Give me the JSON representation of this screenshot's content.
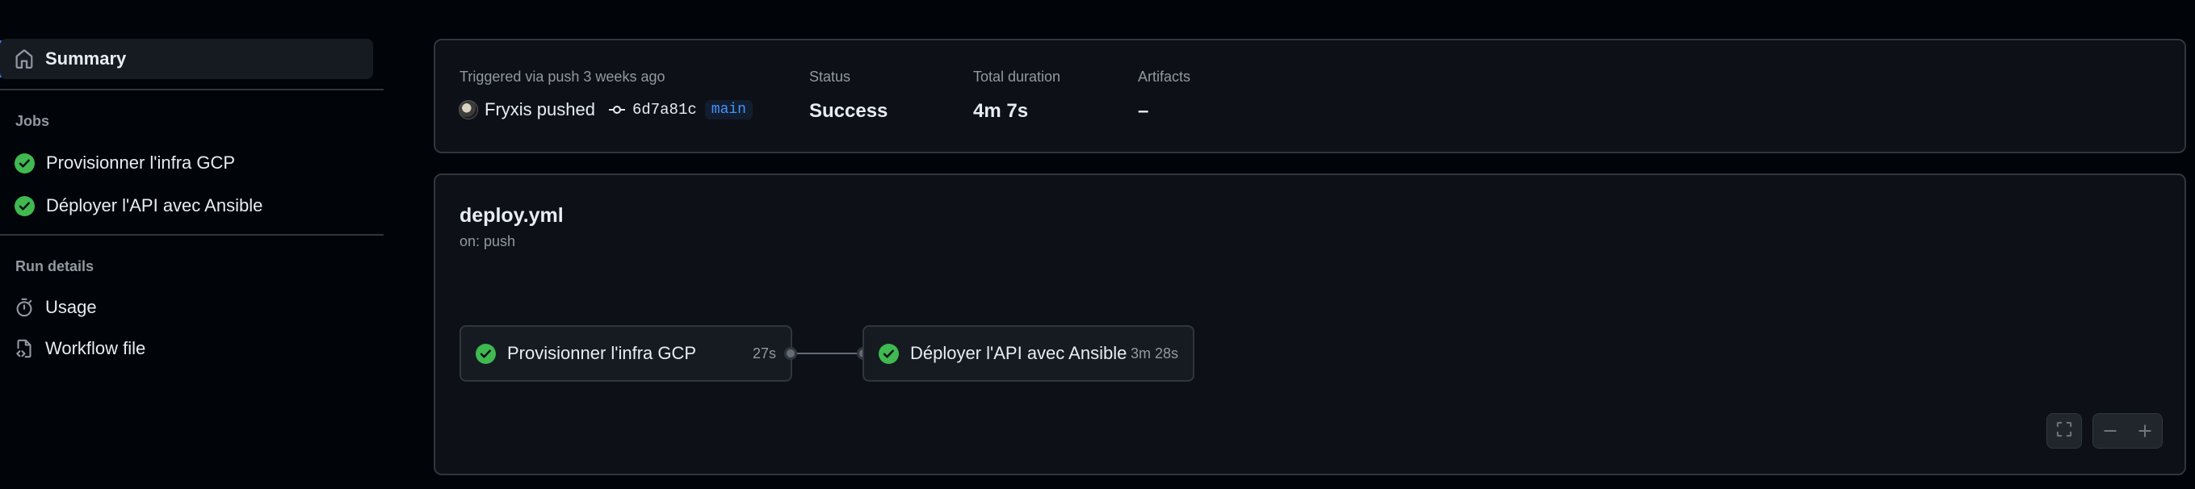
{
  "sidebar": {
    "summary_label": "Summary",
    "jobs_heading": "Jobs",
    "jobs": [
      {
        "label": "Provisionner l'infra GCP",
        "status": "success"
      },
      {
        "label": "Déployer l'API avec Ansible",
        "status": "success"
      }
    ],
    "run_details_heading": "Run details",
    "usage_label": "Usage",
    "workflow_file_label": "Workflow file"
  },
  "summary_card": {
    "trigger_text": "Triggered via push 3 weeks ago",
    "actor": "Fryxis pushed",
    "commit_sha": "6d7a81c",
    "branch": "main",
    "status_label": "Status",
    "status_value": "Success",
    "duration_label": "Total duration",
    "duration_value": "4m 7s",
    "artifacts_label": "Artifacts",
    "artifacts_value": "–"
  },
  "workflow": {
    "filename": "deploy.yml",
    "trigger": "on: push",
    "jobs": [
      {
        "name": "Provisionner l'infra GCP",
        "duration": "27s",
        "status": "success"
      },
      {
        "name": "Déployer l'API avec Ansible",
        "duration": "3m 28s",
        "status": "success"
      }
    ],
    "controls": [
      "fullscreen-icon",
      "zoom-out-icon",
      "zoom-in-icon"
    ]
  },
  "colors": {
    "background": "#010409",
    "card": "#0d1117",
    "border": "#30363d",
    "success": "#3fb950",
    "accent": "#2f81f7",
    "muted_text": "#9198a1"
  }
}
